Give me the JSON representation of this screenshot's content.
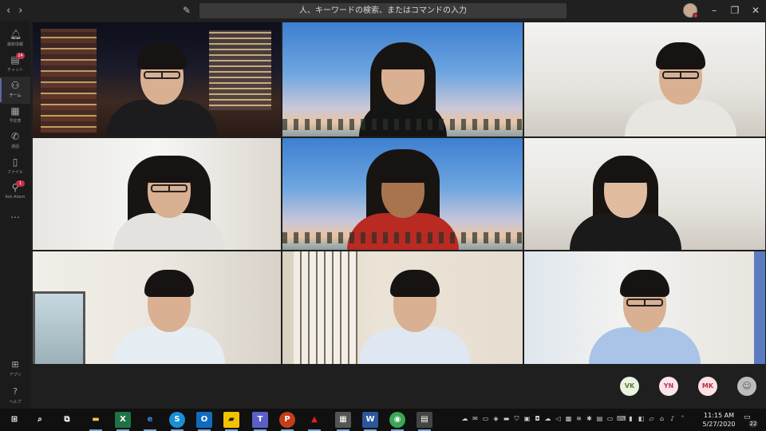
{
  "search": {
    "placeholder": "人、キーワードの検索、またはコマンドの入力"
  },
  "rail": {
    "items": [
      {
        "label": "最新情報",
        "icon": "bell-icon"
      },
      {
        "label": "チャット",
        "icon": "chat-icon",
        "badge": "14"
      },
      {
        "label": "チーム",
        "icon": "teams-icon"
      },
      {
        "label": "予定表",
        "icon": "calendar-icon"
      },
      {
        "label": "通話",
        "icon": "phone-icon"
      },
      {
        "label": "ファイル",
        "icon": "files-icon"
      },
      {
        "label": "Ask Adam",
        "icon": "ask-adam-icon",
        "badge": "1"
      }
    ],
    "more": "…",
    "apps_label": "アプリ",
    "help_label": "ヘルプ"
  },
  "participants": [
    {
      "initials": "VK"
    },
    {
      "initials": "YN"
    },
    {
      "initials": "MK"
    }
  ],
  "clock": {
    "time": "11:15 AM",
    "date": "5/27/2020"
  },
  "notifications": {
    "count": "22"
  },
  "colors": {
    "accent": "#6264a7",
    "badge": "#c4314b"
  }
}
